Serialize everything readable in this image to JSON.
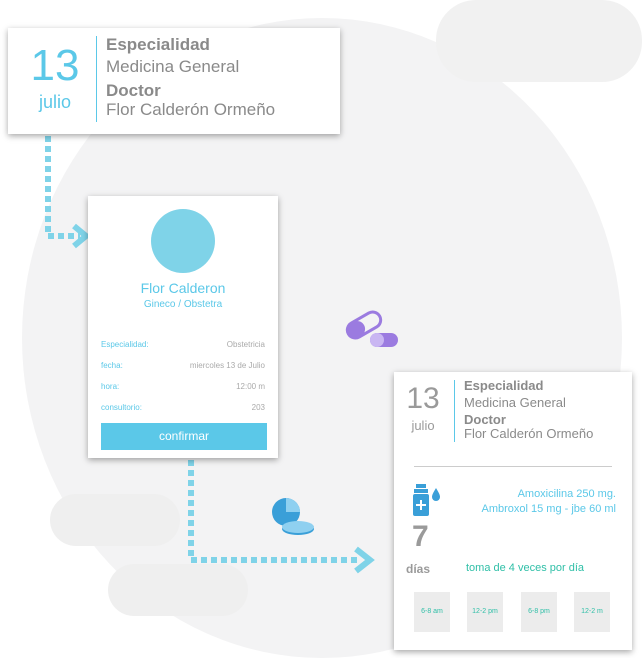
{
  "appointment": {
    "day": "13",
    "month": "julio",
    "specialty_label": "Especialidad",
    "specialty": "Medicina General",
    "doctor_label": "Doctor",
    "doctor": "Flor Calderón Ormeño"
  },
  "profile": {
    "name": "Flor Calderon",
    "subtitle": "Gineco / Obstetra",
    "rows": [
      {
        "label": "Especialidad:",
        "value": "Obstetricia"
      },
      {
        "label": "fecha:",
        "value": "miercoles 13 de Julio"
      },
      {
        "label": "hora:",
        "value": "12:00 m"
      },
      {
        "label": "consultorio:",
        "value": "203"
      }
    ],
    "confirm_label": "confirmar"
  },
  "prescription": {
    "day": "13",
    "month": "julio",
    "specialty_label": "Especialidad",
    "specialty": "Medicina General",
    "doctor_label": "Doctor",
    "doctor": "Flor Calderón Ormeño",
    "medicines": [
      "Amoxicilina 250 mg.",
      "Ambroxol 15 mg - jbe 60 ml"
    ],
    "duration_number": "7",
    "duration_unit": "días",
    "frequency": "toma de 4 veces por día",
    "slots": [
      "6-8 am",
      "12-2 pm",
      "6-8 pm",
      "12-2 m"
    ]
  },
  "colors": {
    "accent": "#5bc8e8",
    "teal": "#2fbfa7",
    "pill": "#9b7be0",
    "text_gray": "#8a8a8a"
  },
  "icons": [
    "pill-capsule-icon",
    "pie-tablet-icon",
    "medicine-bottle-icon",
    "arrow-right-icon"
  ]
}
